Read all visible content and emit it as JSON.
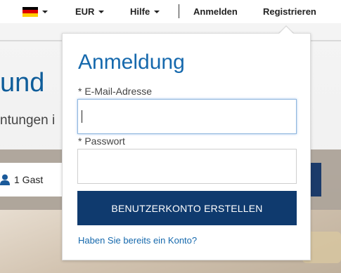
{
  "topbar": {
    "flag_colors": [
      "#000000",
      "#dd0000",
      "#ffce00"
    ],
    "currency_label": "EUR",
    "help_label": "Hilfe",
    "login_label": "Anmelden",
    "register_label": "Registrieren"
  },
  "hero": {
    "title_fragment": "und",
    "subtitle_fragment": "ntungen i",
    "guest_label": "1 Gast"
  },
  "login_panel": {
    "title": "Anmeldung",
    "email_label": "* E-Mail-Adresse",
    "email_value": "",
    "password_label": "* Passwort",
    "password_value": "",
    "submit_label": "BENUTZERKONTO ERSTELLEN",
    "existing_account_link": "Haben Sie bereits ein Konto?"
  },
  "colors": {
    "brand_blue": "#1669ad",
    "button_navy": "#0f3a6e"
  }
}
